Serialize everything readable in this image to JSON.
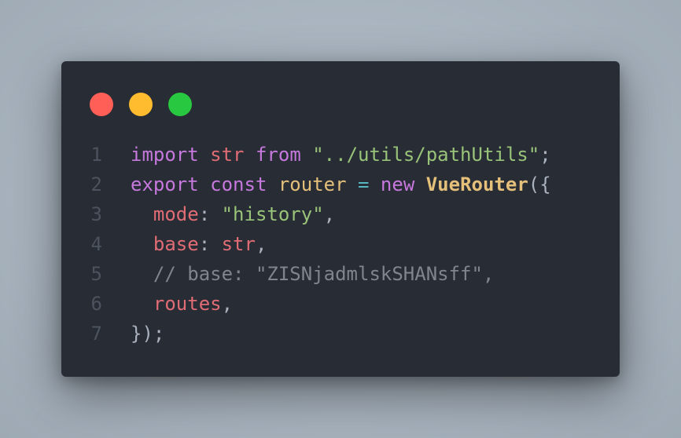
{
  "window": {
    "dots": [
      {
        "name": "close",
        "color": "#ff5f57"
      },
      {
        "name": "minimize",
        "color": "#febc2e"
      },
      {
        "name": "maximize",
        "color": "#28c840"
      }
    ]
  },
  "code": {
    "lines": [
      {
        "number": "1",
        "tokens": [
          {
            "text": "import",
            "type": "kw"
          },
          {
            "text": " ",
            "type": "punc"
          },
          {
            "text": "str",
            "type": "var"
          },
          {
            "text": " ",
            "type": "punc"
          },
          {
            "text": "from",
            "type": "kw"
          },
          {
            "text": " ",
            "type": "punc"
          },
          {
            "text": "\"../utils/pathUtils\"",
            "type": "str"
          },
          {
            "text": ";",
            "type": "punc"
          }
        ]
      },
      {
        "number": "2",
        "tokens": [
          {
            "text": "export",
            "type": "kw"
          },
          {
            "text": " ",
            "type": "punc"
          },
          {
            "text": "const",
            "type": "kw"
          },
          {
            "text": " ",
            "type": "punc"
          },
          {
            "text": "router",
            "type": "def"
          },
          {
            "text": " ",
            "type": "punc"
          },
          {
            "text": "=",
            "type": "op"
          },
          {
            "text": " ",
            "type": "punc"
          },
          {
            "text": "new",
            "type": "kw"
          },
          {
            "text": " ",
            "type": "punc"
          },
          {
            "text": "VueRouter",
            "type": "cls"
          },
          {
            "text": "({",
            "type": "punc"
          }
        ]
      },
      {
        "number": "3",
        "tokens": [
          {
            "text": "  ",
            "type": "punc"
          },
          {
            "text": "mode",
            "type": "var"
          },
          {
            "text": ": ",
            "type": "punc"
          },
          {
            "text": "\"history\"",
            "type": "str"
          },
          {
            "text": ",",
            "type": "punc"
          }
        ]
      },
      {
        "number": "4",
        "tokens": [
          {
            "text": "  ",
            "type": "punc"
          },
          {
            "text": "base",
            "type": "var"
          },
          {
            "text": ": ",
            "type": "punc"
          },
          {
            "text": "str",
            "type": "var"
          },
          {
            "text": ",",
            "type": "punc"
          }
        ]
      },
      {
        "number": "5",
        "tokens": [
          {
            "text": "  ",
            "type": "punc"
          },
          {
            "text": "// base: \"ZISNjadmlskSHANsff\",",
            "type": "cmt"
          }
        ]
      },
      {
        "number": "6",
        "tokens": [
          {
            "text": "  ",
            "type": "punc"
          },
          {
            "text": "routes",
            "type": "var"
          },
          {
            "text": ",",
            "type": "punc"
          }
        ]
      },
      {
        "number": "7",
        "tokens": [
          {
            "text": "});",
            "type": "punc"
          }
        ]
      }
    ]
  }
}
